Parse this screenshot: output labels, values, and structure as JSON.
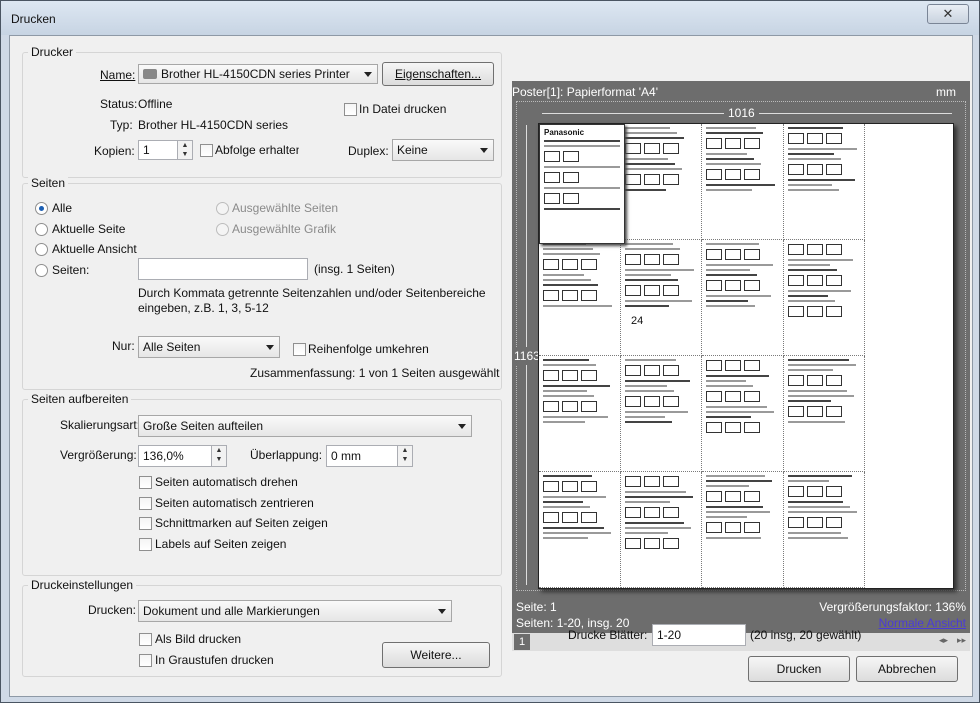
{
  "window": {
    "title": "Drucken",
    "close_symbol": "✕"
  },
  "printer": {
    "section": "Drucker",
    "name_label": "Name:",
    "name_value": "Brother HL-4150CDN series Printer",
    "properties_button": "Eigenschaften...",
    "status_label": "Status:",
    "status_value": "Offline",
    "type_label": "Typ:",
    "type_value": "Brother HL-4150CDN series",
    "print_to_file": "In Datei drucken",
    "copies_label": "Kopien:",
    "copies_value": "1",
    "collate": "Abfolge erhalten",
    "duplex_label": "Duplex:",
    "duplex_value": "Keine"
  },
  "pages": {
    "section": "Seiten",
    "all": "Alle",
    "current_page": "Aktuelle Seite",
    "current_view": "Aktuelle Ansicht",
    "pages_label": "Seiten:",
    "pages_value": "",
    "pages_count": "(insg. 1 Seiten)",
    "selected_pages": "Ausgewählte Seiten",
    "selected_graphic": "Ausgewählte Grafik",
    "hint_line1": "Durch Kommata getrennte Seitenzahlen und/oder Seitenbereiche",
    "hint_line2": "eingeben, z.B. 1, 3, 5-12",
    "only_label": "Nur:",
    "only_value": "Alle Seiten",
    "reverse": "Reihenfolge umkehren",
    "summary": "Zusammenfassung: 1 von 1 Seiten ausgewählt"
  },
  "page_setup": {
    "section": "Seiten aufbereiten",
    "scaling_label": "Skalierungsart:",
    "scaling_value": "Große Seiten aufteilen",
    "zoom_label": "Vergrößerung:",
    "zoom_value": "136,0%",
    "overlap_label": "Überlappung:",
    "overlap_value": "0 mm",
    "auto_rotate": "Seiten automatisch drehen",
    "auto_center": "Seiten automatisch zentrieren",
    "cut_marks": "Schnittmarken auf Seiten zeigen",
    "labels": "Labels auf Seiten zeigen"
  },
  "print_settings": {
    "section": "Druckeinstellungen",
    "print_label": "Drucken:",
    "print_value": "Dokument und alle Markierungen",
    "as_image": "Als Bild drucken",
    "grayscale": "In Graustufen drucken",
    "more_button": "Weitere..."
  },
  "preview": {
    "header": "Poster[1]: Papierformat 'A4'",
    "unit": "mm",
    "width_dim": "1016",
    "height_dim": "1163",
    "page_info": "Seite: 1",
    "pages_info": "Seiten: 1-20, insg. 20",
    "zoom_factor": "Vergrößerungsfaktor: 136%",
    "normal_view_link": "Normale Ansicht",
    "thumb_page": "1",
    "logo_text": "Panasonic",
    "tile_number": "24"
  },
  "footer": {
    "sheets_label": "Drucke Blätter:",
    "sheets_value": "1-20",
    "sheets_info": "(20 insg, 20 gewählt)",
    "print_button": "Drucken",
    "cancel_button": "Abbrechen"
  },
  "colors": {
    "link": "#4b3bd6",
    "radio_accent": "#1c5fb3",
    "preview_bg": "#6d6d6d"
  }
}
